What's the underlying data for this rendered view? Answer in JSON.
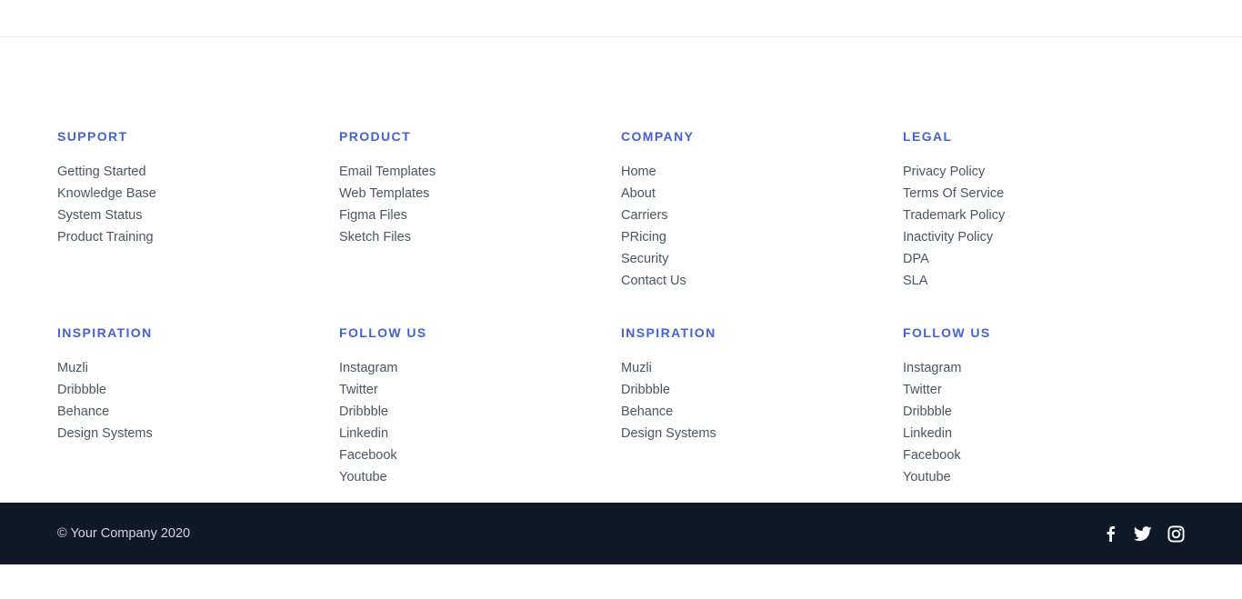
{
  "columns": [
    {
      "heading": "SUPPORT",
      "links": [
        "Getting Started",
        "Knowledge Base",
        "System Status",
        "Product Training"
      ]
    },
    {
      "heading": "PRODUCT",
      "links": [
        "Email Templates",
        "Web Templates",
        "Figma Files",
        "Sketch Files"
      ]
    },
    {
      "heading": "COMPANY",
      "links": [
        "Home",
        "About",
        "Carriers",
        "PRicing",
        "Security",
        "Contact Us"
      ]
    },
    {
      "heading": "LEGAL",
      "links": [
        "Privacy Policy",
        "Terms Of Service",
        "Trademark Policy",
        "Inactivity Policy",
        "DPA",
        "SLA"
      ]
    },
    {
      "heading": "INSPIRATION",
      "links": [
        "Muzli",
        "Dribbble",
        "Behance",
        "Design Systems"
      ]
    },
    {
      "heading": "FOLLOW US",
      "links": [
        "Instagram",
        "Twitter",
        "Dribbble",
        "Linkedin",
        "Facebook",
        "Youtube"
      ]
    },
    {
      "heading": "INSPIRATION",
      "links": [
        "Muzli",
        "Dribbble",
        "Behance",
        "Design Systems"
      ]
    },
    {
      "heading": "FOLLOW US",
      "links": [
        "Instagram",
        "Twitter",
        "Dribbble",
        "Linkedin",
        "Facebook",
        "Youtube"
      ]
    }
  ],
  "bottom_bar": {
    "copyright": "© Your Company 2020",
    "social_icons": [
      "facebook-icon",
      "twitter-icon",
      "instagram-icon"
    ]
  },
  "colors": {
    "heading": "#4361d8",
    "link": "#4b5563",
    "bar_background": "#111827",
    "bar_text": "#d1d5db"
  }
}
